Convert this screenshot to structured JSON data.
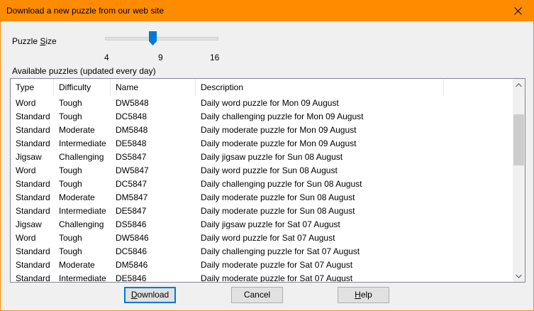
{
  "window": {
    "title": "Download a new puzzle from our web site",
    "accent": "#ff8c00"
  },
  "puzzle_size": {
    "label_pre": "Puzzle ",
    "label_accel": "S",
    "label_post": "ize",
    "min_label": "4",
    "current_label": "9",
    "max_label": "16",
    "min": 4,
    "max": 16,
    "value": 9
  },
  "list": {
    "label": "Available puzzles (updated every day)",
    "columns": [
      "Type",
      "Difficulty",
      "Name",
      "Description"
    ],
    "rows": [
      [
        "Word",
        "Tough",
        "DW5848",
        "Daily word puzzle for Mon 09 August"
      ],
      [
        "Standard",
        "Tough",
        "DC5848",
        "Daily challenging puzzle for Mon 09 August"
      ],
      [
        "Standard",
        "Moderate",
        "DM5848",
        "Daily moderate puzzle for Mon 09 August"
      ],
      [
        "Standard",
        "Intermediate",
        "DE5848",
        "Daily moderate puzzle for Mon 09 August"
      ],
      [
        "Jigsaw",
        "Challenging",
        "DS5847",
        "Daily jigsaw puzzle for Sun 08 August"
      ],
      [
        "Word",
        "Tough",
        "DW5847",
        "Daily word puzzle for Sun 08 August"
      ],
      [
        "Standard",
        "Tough",
        "DC5847",
        "Daily challenging puzzle for Sun 08 August"
      ],
      [
        "Standard",
        "Moderate",
        "DM5847",
        "Daily moderate puzzle for Sun 08 August"
      ],
      [
        "Standard",
        "Intermediate",
        "DE5847",
        "Daily moderate puzzle for Sun 08 August"
      ],
      [
        "Jigsaw",
        "Challenging",
        "DS5846",
        "Daily jigsaw puzzle for Sat 07 August"
      ],
      [
        "Word",
        "Tough",
        "DW5846",
        "Daily word puzzle for Sat 07 August"
      ],
      [
        "Standard",
        "Tough",
        "DC5846",
        "Daily challenging puzzle for Sat 07 August"
      ],
      [
        "Standard",
        "Moderate",
        "DM5846",
        "Daily moderate puzzle for Sat 07 August"
      ],
      [
        "Standard",
        "Intermediate",
        "DE5846",
        "Daily moderate puzzle for Sat 07 August"
      ]
    ]
  },
  "buttons": {
    "download": {
      "accel": "D",
      "rest": "ownload"
    },
    "cancel": {
      "label": "Cancel"
    },
    "help": {
      "accel": "H",
      "rest": "elp"
    }
  },
  "icons": {
    "close": "close-icon",
    "scroll_up": "chevron-up-icon",
    "scroll_down": "chevron-down-icon",
    "slider_thumb": "slider-thumb-icon"
  }
}
